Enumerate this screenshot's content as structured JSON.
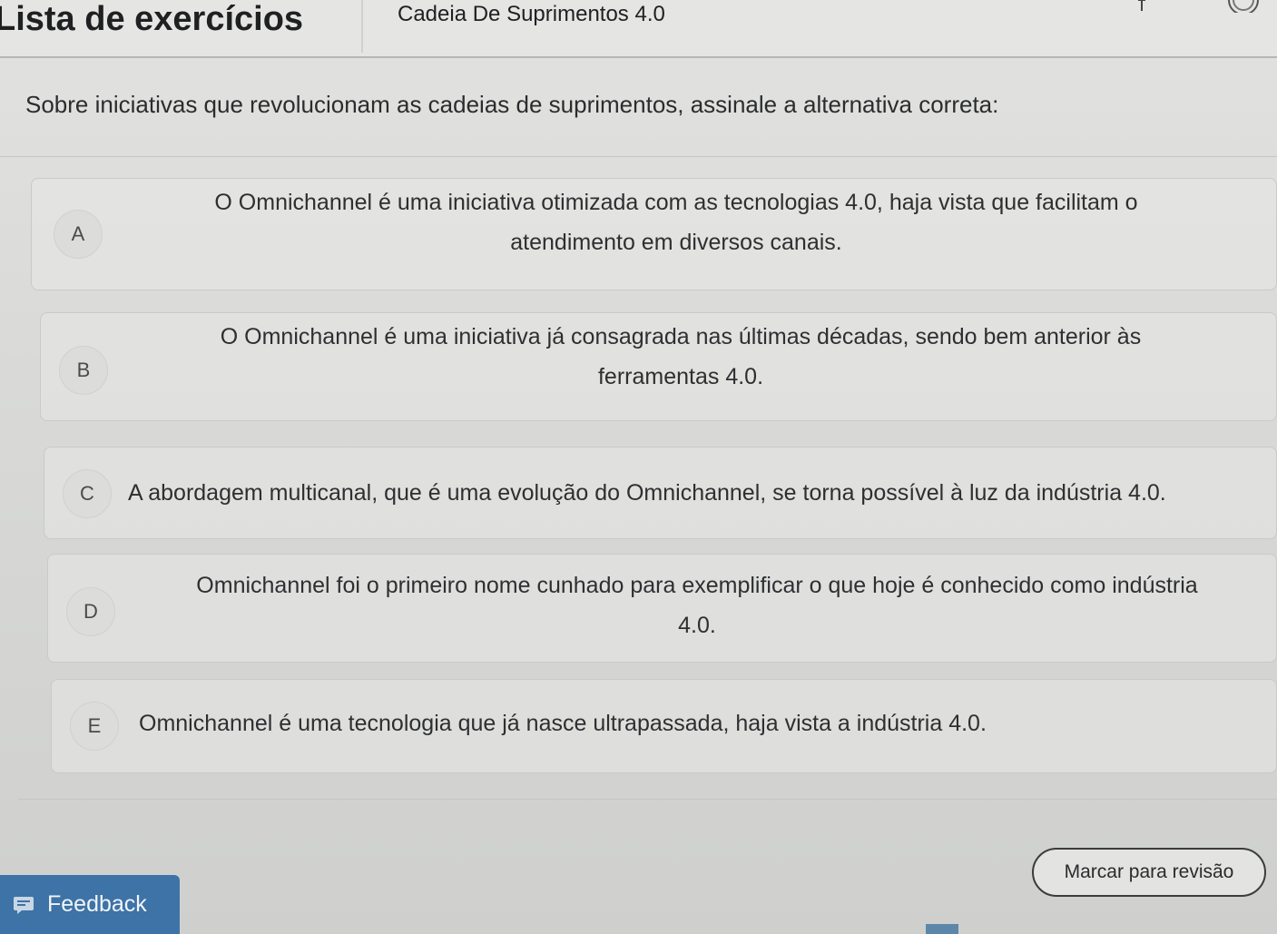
{
  "header": {
    "title": "Lista de exercícios",
    "subtitle": "Cadeia De Suprimentos 4.0"
  },
  "question": {
    "text": "Sobre iniciativas que revolucionam as cadeias de suprimentos, assinale a alternativa correta:"
  },
  "options": [
    {
      "letter": "A",
      "line1": "O Omnichannel é uma iniciativa otimizada com as tecnologias 4.0, haja vista que facilitam o",
      "line2": "atendimento em diversos canais."
    },
    {
      "letter": "B",
      "line1": "O Omnichannel é uma iniciativa já consagrada nas últimas décadas, sendo bem anterior às",
      "line2": "ferramentas 4.0."
    },
    {
      "letter": "C",
      "line1": "A abordagem multicanal, que é uma evolução do Omnichannel, se torna possível à luz da indústria 4.0."
    },
    {
      "letter": "D",
      "line1": "Omnichannel foi o primeiro nome cunhado para exemplificar o que hoje é conhecido como indústria",
      "line2": "4.0."
    },
    {
      "letter": "E",
      "line1": "Omnichannel é uma tecnologia que já nasce ultrapassada, haja vista a indústria 4.0."
    }
  ],
  "footer": {
    "review_label": "Marcar para revisão",
    "feedback_label": "Feedback"
  },
  "colors": {
    "feedback_bg": "#3d73a7",
    "page_bg": "#dcdcda",
    "text": "#2e2f31"
  },
  "icons": {
    "feedback": "feedback-icon",
    "bookmark": "bookmark-icon",
    "avatar": "avatar-icon"
  }
}
